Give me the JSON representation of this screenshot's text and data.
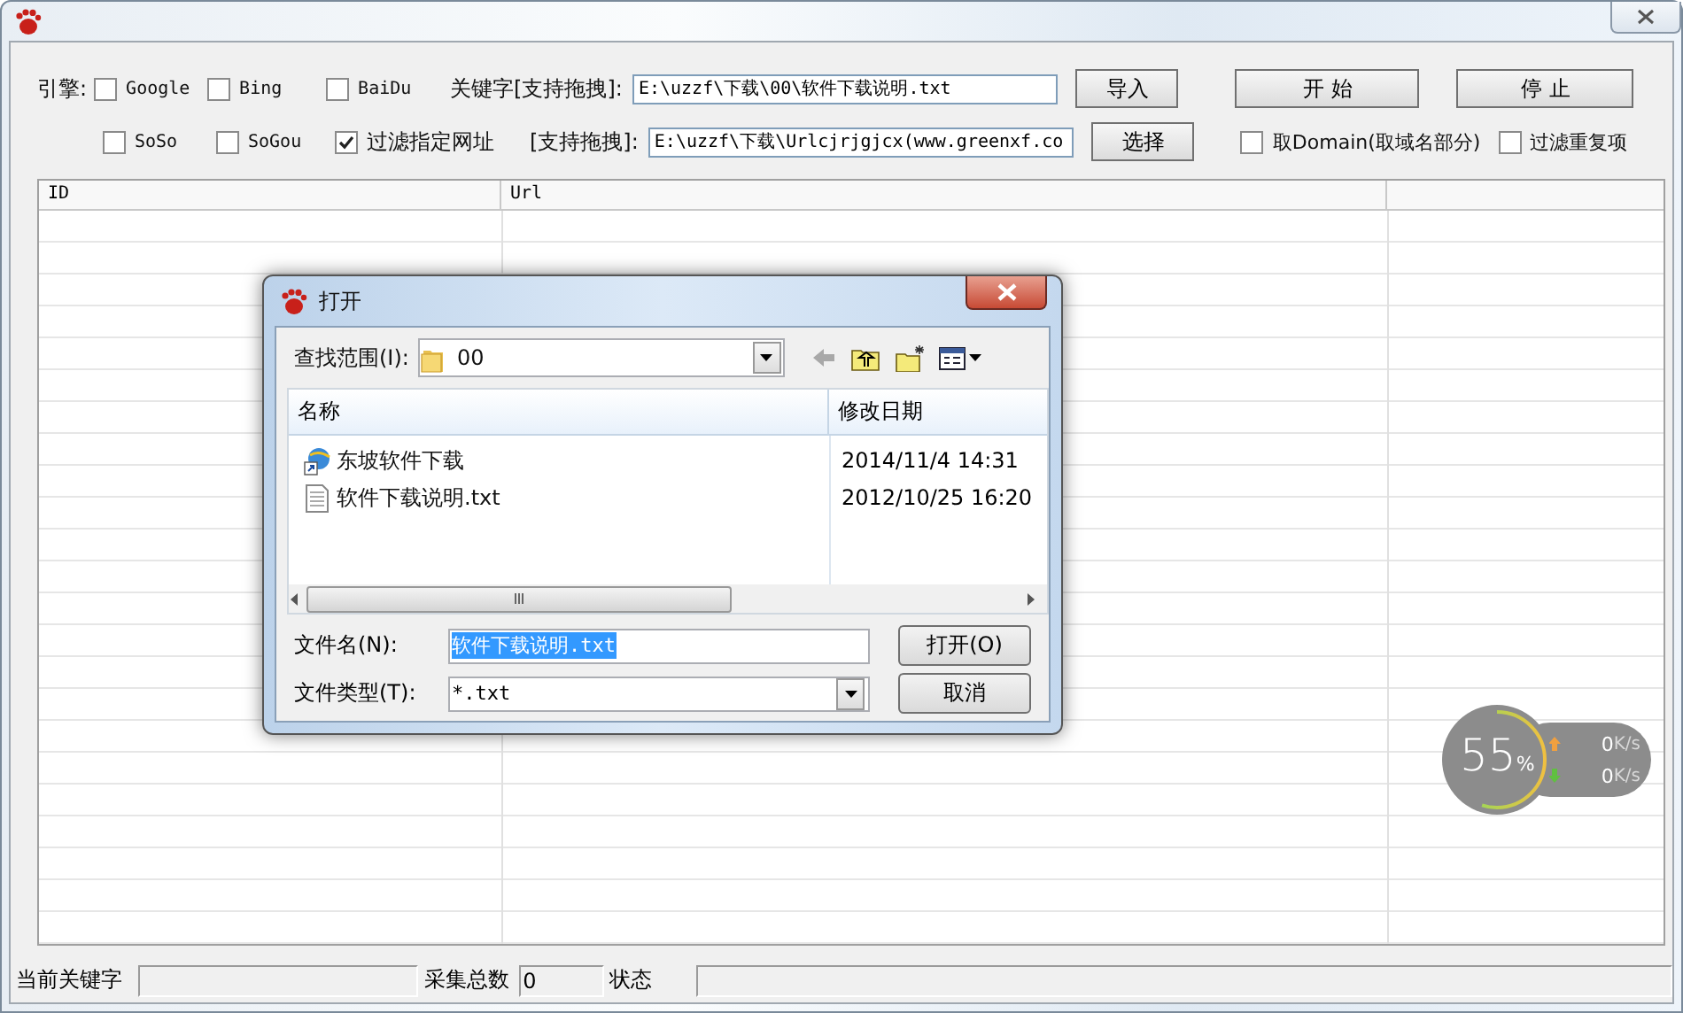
{
  "top_row": {
    "engines_label": "引擎:",
    "engines": [
      {
        "label": "Google",
        "checked": false
      },
      {
        "label": "Bing",
        "checked": false
      },
      {
        "label": "BaiDu",
        "checked": false
      }
    ],
    "field_label": "关键字[支持拖拽]:",
    "value": "E:\\uzzf\\下载\\00\\软件下载说明.txt",
    "button": "导入"
  },
  "second_row": {
    "engines": [
      {
        "label": "SoSo",
        "checked": false
      },
      {
        "label": "SoGou",
        "checked": false
      }
    ],
    "filter": {
      "label": "过滤指定网址",
      "checked": true
    },
    "field_label": "[支持拖拽]:",
    "value": "E:\\uzzf\\下载\\Urlcjrjgjcx(www.greenxf.co",
    "button": "选择"
  },
  "start_button": "开 始",
  "stop_button": "停 止",
  "options": [
    {
      "label": "取Domain(取域名部分)",
      "checked": false
    },
    {
      "label": "过滤重复项",
      "checked": false
    }
  ],
  "table": {
    "columns": [
      "ID",
      "Url"
    ]
  },
  "status_bar": [
    {
      "kind": "label",
      "text": "当前关键字"
    },
    {
      "kind": "field"
    },
    {
      "kind": "label",
      "text": "采集总数"
    },
    {
      "kind": "field",
      "text": "0"
    },
    {
      "kind": "label",
      "text": "状态"
    },
    {
      "kind": "field"
    }
  ],
  "dialog": {
    "title": "打开",
    "look_in_label": "查找范围(I):",
    "look_in_value": "00",
    "columns": [
      "名称",
      "修改日期"
    ],
    "files": [
      {
        "kind": "shortcut",
        "name": "东坡软件下载",
        "date": "2014/11/4 14:31"
      },
      {
        "kind": "text-file",
        "name": "软件下载说明.txt",
        "date": "2012/10/25 16:20"
      }
    ],
    "filename_label": "文件名(N):",
    "filename_value": "软件下载说明.txt",
    "filetype_label": "文件类型(T):",
    "filetype_value": "*.txt",
    "open_button": "打开(O)",
    "cancel_button": "取消"
  },
  "speed_widget": {
    "percent": "55",
    "percent_unit": "%",
    "level": 0.55,
    "upload": {
      "value": "0",
      "unit": "K/s"
    },
    "download": {
      "value": "0",
      "unit": "K/s"
    }
  }
}
